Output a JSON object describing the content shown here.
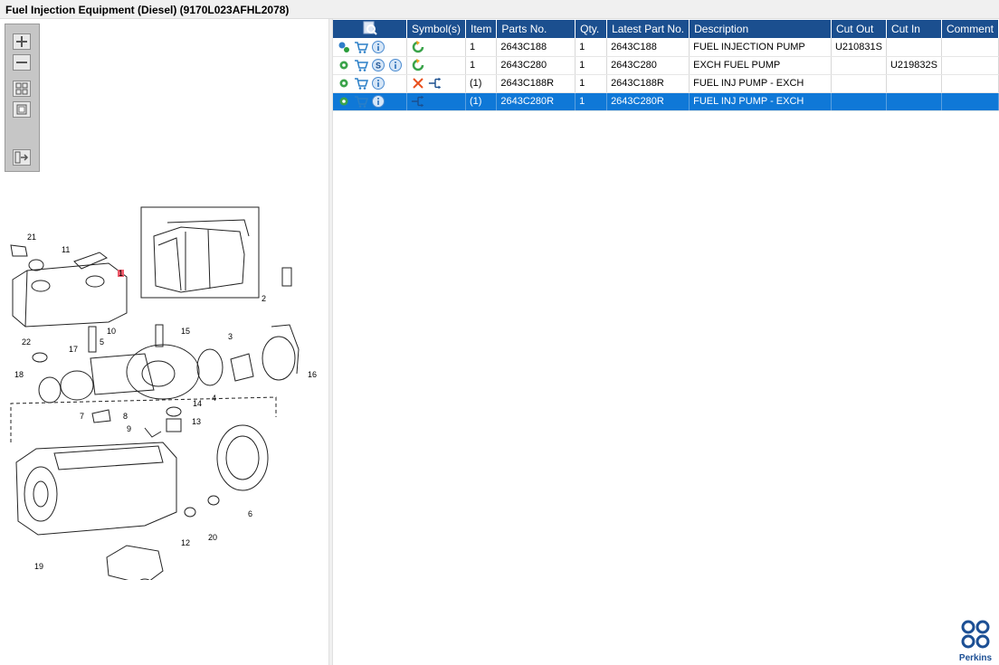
{
  "window": {
    "title": "Fuel Injection Equipment (Diesel) (9170L023AFHL2078)"
  },
  "toolbar": {
    "zoom_in_icon": "zoom-in-icon",
    "zoom_out_icon": "zoom-out-icon",
    "fit_all_icon": "fit-all-icon",
    "fit_page_icon": "fit-page-icon",
    "export_icon": "export-icon"
  },
  "diagram": {
    "callouts": [
      "21",
      "11",
      "1",
      "2",
      "22",
      "10",
      "5",
      "15",
      "3",
      "17",
      "16",
      "18",
      "4",
      "14",
      "7",
      "8",
      "13",
      "9",
      "6",
      "20",
      "19",
      "12"
    ]
  },
  "table": {
    "columns": [
      "",
      "Symbol(s)",
      "Item",
      "Parts No.",
      "Qty.",
      "Latest Part No.",
      "Description",
      "Cut Out",
      "Cut In",
      "Comment"
    ],
    "rows": [
      {
        "icons": [
          "gears-icon",
          "cart-icon",
          "info-icon"
        ],
        "symbols": [
          "refresh-icon"
        ],
        "item": "1",
        "part_no": "2643C188",
        "qty": "1",
        "latest": "2643C188",
        "description": "FUEL INJECTION PUMP",
        "cut_out": "U210831S",
        "cut_in": "",
        "comment": ""
      },
      {
        "icons": [
          "gear-icon",
          "cart-icon",
          "s-icon",
          "info-icon"
        ],
        "symbols": [
          "refresh-icon"
        ],
        "item": "1",
        "part_no": "2643C280",
        "qty": "1",
        "latest": "2643C280",
        "description": "EXCH FUEL PUMP",
        "cut_out": "",
        "cut_in": "U219832S",
        "comment": ""
      },
      {
        "icons": [
          "gear-icon",
          "cart-icon",
          "info-icon"
        ],
        "symbols": [
          "cross-icon",
          "exchange-icon"
        ],
        "item": "(1)",
        "part_no": "2643C188R",
        "qty": "1",
        "latest": "2643C188R",
        "description": "FUEL INJ PUMP - EXCH",
        "cut_out": "",
        "cut_in": "",
        "comment": ""
      },
      {
        "icons": [
          "gear-icon",
          "cart-icon",
          "info-icon"
        ],
        "symbols": [
          "exchange-icon"
        ],
        "item": "(1)",
        "part_no": "2643C280R",
        "qty": "1",
        "latest": "2643C280R",
        "description": "FUEL INJ PUMP - EXCH",
        "cut_out": "",
        "cut_in": "",
        "comment": "",
        "selected": true
      }
    ]
  },
  "brand": {
    "name": "Perkins",
    "color": "#1c4f94"
  },
  "colors": {
    "header": "#1b4f8f",
    "selected_row": "#0f78d7"
  }
}
